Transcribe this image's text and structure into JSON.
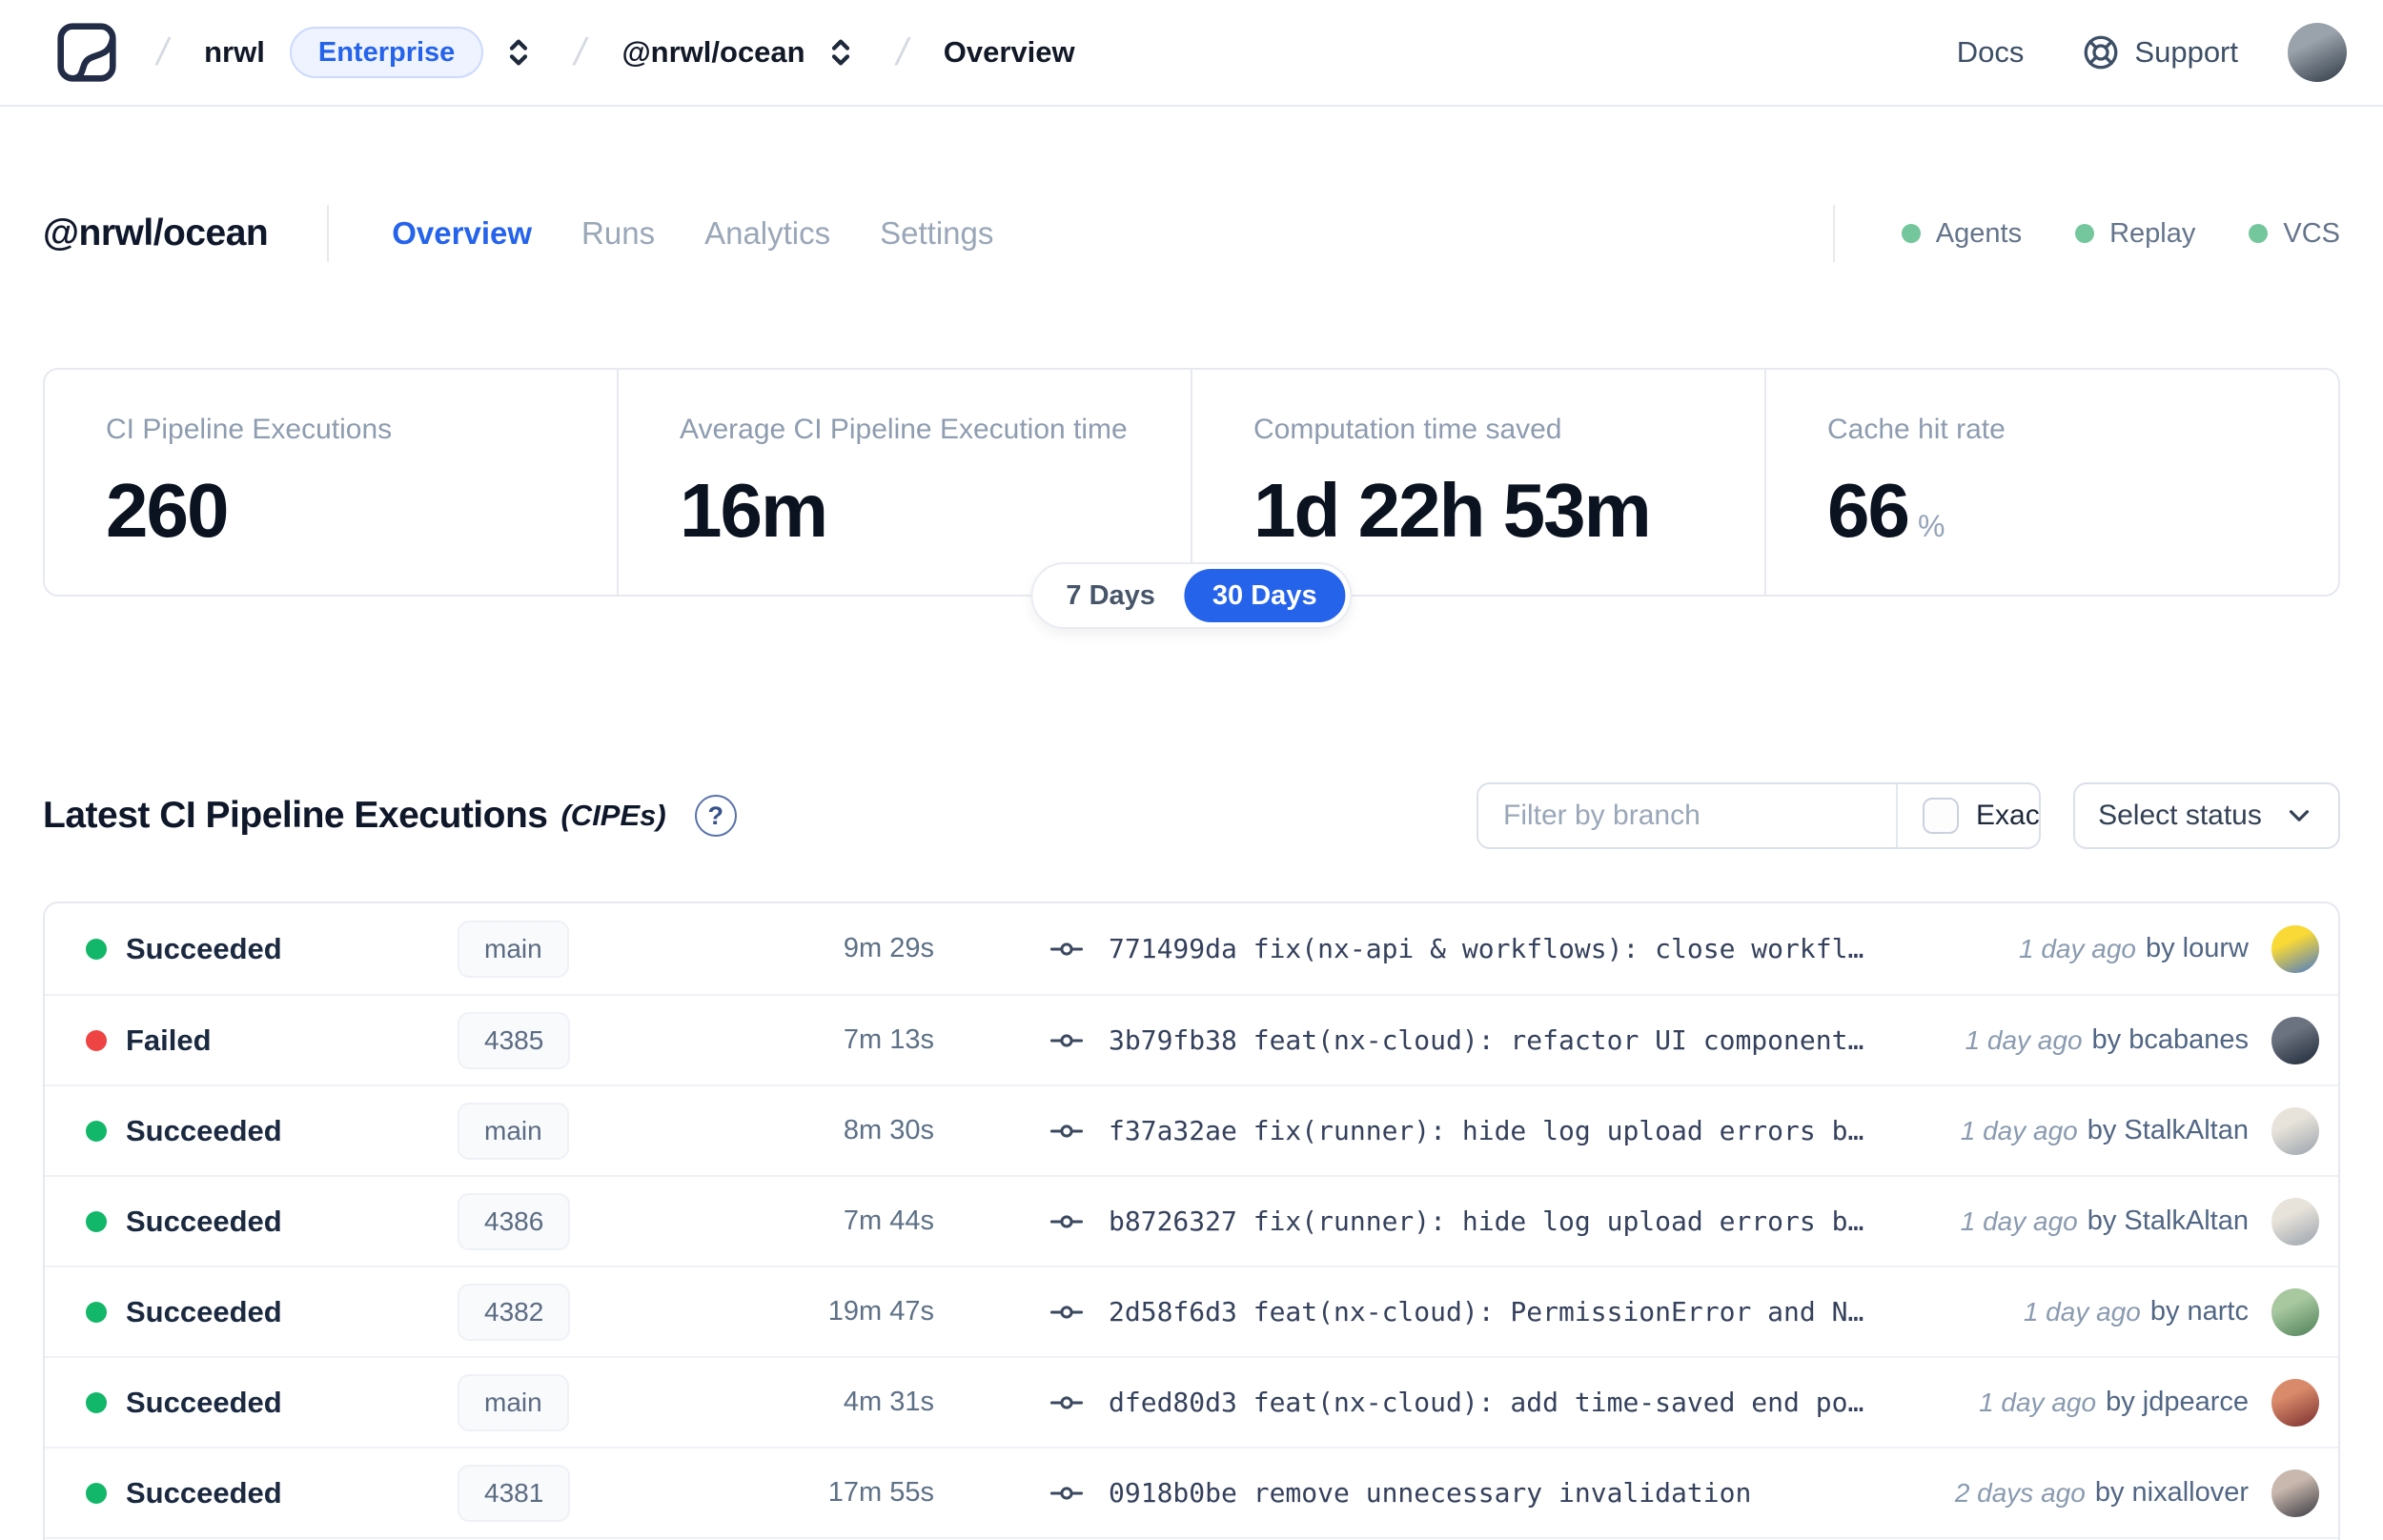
{
  "nav": {
    "breadcrumb": {
      "org": "nrwl",
      "org_badge": "Enterprise",
      "workspace": "@nrwl/ocean",
      "page": "Overview"
    },
    "docs_label": "Docs",
    "support_label": "Support"
  },
  "workspace_header": {
    "title": "@nrwl/ocean",
    "tabs": [
      {
        "label": "Overview"
      },
      {
        "label": "Runs"
      },
      {
        "label": "Analytics"
      },
      {
        "label": "Settings"
      }
    ],
    "integrations": [
      {
        "label": "Agents"
      },
      {
        "label": "Replay"
      },
      {
        "label": "VCS"
      }
    ],
    "integration_dot_color": "#74c69d"
  },
  "stats": {
    "cards": [
      {
        "label": "CI Pipeline Executions",
        "value": "260",
        "suffix": ""
      },
      {
        "label": "Average CI Pipeline Execution time",
        "value": "16m",
        "suffix": ""
      },
      {
        "label": "Computation time saved",
        "value": "1d 22h 53m",
        "suffix": ""
      },
      {
        "label": "Cache hit rate",
        "value": "66",
        "suffix": "%"
      }
    ],
    "range_toggle": {
      "options": [
        "7 Days",
        "30 Days"
      ],
      "selected": "30 Days"
    }
  },
  "cipes": {
    "title": "Latest CI Pipeline Executions",
    "title_suffix": "(CIPEs)",
    "help_glyph": "?",
    "filter_placeholder": "Filter by branch",
    "exact_label": "Exact",
    "status_select_label": "Select status",
    "rows": [
      {
        "status": "Succeeded",
        "status_color": "#12b76a",
        "branch": "main",
        "duration": "9m 29s",
        "commit": "771499da fix(nx-api & workflows): close workfl…",
        "time_ago": "1 day ago",
        "author": "by lourw",
        "avatar": [
          "#f8d936",
          "#4a79c9"
        ]
      },
      {
        "status": "Failed",
        "status_color": "#ef4444",
        "branch": "4385",
        "duration": "7m 13s",
        "commit": "3b79fb38 feat(nx-cloud): refactor UI component…",
        "time_ago": "1 day ago",
        "author": "by bcabanes",
        "avatar": [
          "#6b7280",
          "#1f2937"
        ]
      },
      {
        "status": "Succeeded",
        "status_color": "#12b76a",
        "branch": "main",
        "duration": "8m 30s",
        "commit": "f37a32ae fix(runner): hide log upload errors b…",
        "time_ago": "1 day ago",
        "author": "by StalkAltan",
        "avatar": [
          "#e8e3da",
          "#9aa3ad"
        ]
      },
      {
        "status": "Succeeded",
        "status_color": "#12b76a",
        "branch": "4386",
        "duration": "7m 44s",
        "commit": "b8726327 fix(runner): hide log upload errors b…",
        "time_ago": "1 day ago",
        "author": "by StalkAltan",
        "avatar": [
          "#e8e3da",
          "#9aa3ad"
        ]
      },
      {
        "status": "Succeeded",
        "status_color": "#12b76a",
        "branch": "4382",
        "duration": "19m 47s",
        "commit": "2d58f6d3 feat(nx-cloud): PermissionError and N…",
        "time_ago": "1 day ago",
        "author": "by nartc",
        "avatar": [
          "#a8c8a0",
          "#4e7f57"
        ]
      },
      {
        "status": "Succeeded",
        "status_color": "#12b76a",
        "branch": "main",
        "duration": "4m 31s",
        "commit": "dfed80d3 feat(nx-cloud): add time-saved end po…",
        "time_ago": "1 day ago",
        "author": "by jdpearce",
        "avatar": [
          "#d98a6a",
          "#7a2e2e"
        ]
      },
      {
        "status": "Succeeded",
        "status_color": "#12b76a",
        "branch": "4381",
        "duration": "17m 55s",
        "commit": "0918b0be remove unnecessary invalidation",
        "time_ago": "2 days ago",
        "author": "by nixallover",
        "avatar": [
          "#c9b8ae",
          "#3a3a42"
        ]
      }
    ]
  },
  "colors": {
    "accent_blue": "#2563eb",
    "succeeded_green": "#12b76a",
    "failed_red": "#ef4444",
    "integration_green": "#74c69d"
  },
  "nav_avatar": [
    "#9aa2ab",
    "#2f3a45"
  ]
}
